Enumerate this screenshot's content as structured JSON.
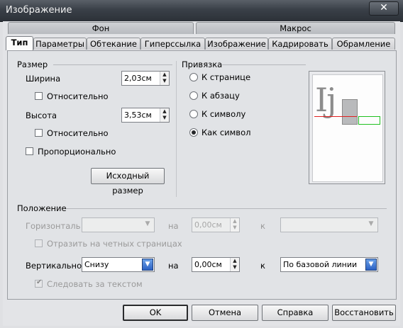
{
  "window": {
    "title": "Изображение",
    "close_symbol": "✕"
  },
  "tabs_row1": [
    "Фон",
    "Макрос"
  ],
  "tabs_row2": [
    "Тип",
    "Параметры",
    "Обтекание",
    "Гиперссылка",
    "Изображение",
    "Кадрировать",
    "Обрамление"
  ],
  "size": {
    "section_label": "Размер",
    "width_label": "Ширина",
    "width_value": "2,03см",
    "relative_label": "Относительно",
    "height_label": "Высота",
    "height_value": "3,53см",
    "relative2_label": "Относительно",
    "proportional_label": "Пропорционально",
    "original_size_button": "Исходный размер"
  },
  "anchor": {
    "section_label": "Привязка",
    "options": [
      "К странице",
      "К абзацу",
      "К символу",
      "Как символ"
    ],
    "selected": "Как символ"
  },
  "preview": {
    "glyph": "Ij"
  },
  "position": {
    "section_label": "Положение",
    "horizontal_label": "Горизонталь",
    "horizontal_value": "",
    "on_label": "на",
    "horizontal_offset": "0,00см",
    "to_label": "к",
    "horizontal_to_value": "",
    "mirror_label": "Отразить на четных страницах",
    "vertical_label": "Вертикально",
    "vertical_value": "Снизу",
    "on2_label": "на",
    "vertical_offset": "0,00см",
    "to2_label": "к",
    "vertical_to_value": "По базовой линии",
    "follow_text_label": "Следовать за текстом"
  },
  "buttons": {
    "ok": "OK",
    "cancel": "Отмена",
    "help": "Справка",
    "reset": "Восстановить"
  },
  "colors": {
    "titlebar": "#3a4048",
    "combo_button": "#2c62c4",
    "preview_baseline": "#e02020",
    "preview_frame": "#20c020"
  }
}
